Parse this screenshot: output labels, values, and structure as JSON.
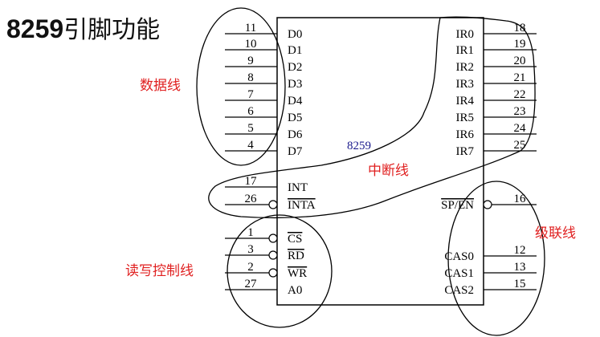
{
  "title": {
    "number": "8259",
    "text": "引脚功能"
  },
  "chip": {
    "label": "8259"
  },
  "colors": {
    "ink": "#000000",
    "red_label": "#e02020",
    "chip_label": "#1a1a8c"
  },
  "left_pins": [
    {
      "num": "11",
      "name": "D0"
    },
    {
      "num": "10",
      "name": "D1"
    },
    {
      "num": "9",
      "name": "D2"
    },
    {
      "num": "8",
      "name": "D3"
    },
    {
      "num": "7",
      "name": "D4"
    },
    {
      "num": "6",
      "name": "D5"
    },
    {
      "num": "5",
      "name": "D6"
    },
    {
      "num": "4",
      "name": "D7"
    },
    {
      "num": "17",
      "name": "INT"
    },
    {
      "num": "26",
      "name": "INTA",
      "overline": true,
      "bubble": true
    },
    {
      "num": "1",
      "name": "CS",
      "overline": true,
      "bubble": true
    },
    {
      "num": "3",
      "name": "RD",
      "overline": true,
      "bubble": true
    },
    {
      "num": "2",
      "name": "WR",
      "overline": true,
      "bubble": true
    },
    {
      "num": "27",
      "name": "A0"
    }
  ],
  "right_pins": [
    {
      "num": "18",
      "name": "IR0"
    },
    {
      "num": "19",
      "name": "IR1"
    },
    {
      "num": "20",
      "name": "IR2"
    },
    {
      "num": "21",
      "name": "IR3"
    },
    {
      "num": "22",
      "name": "IR4"
    },
    {
      "num": "23",
      "name": "IR5"
    },
    {
      "num": "24",
      "name": "IR6"
    },
    {
      "num": "25",
      "name": "IR7"
    },
    {
      "num": "16",
      "name": "SP/EN",
      "overline": true,
      "bubble": true
    },
    {
      "num": "12",
      "name": "CAS0"
    },
    {
      "num": "13",
      "name": "CAS1"
    },
    {
      "num": "15",
      "name": "CAS2"
    }
  ],
  "groups": [
    {
      "id": "data",
      "label": "数据线"
    },
    {
      "id": "interrupt",
      "label": "中断线"
    },
    {
      "id": "cascade",
      "label": "级联线"
    },
    {
      "id": "control",
      "label": "读写控制线"
    }
  ]
}
